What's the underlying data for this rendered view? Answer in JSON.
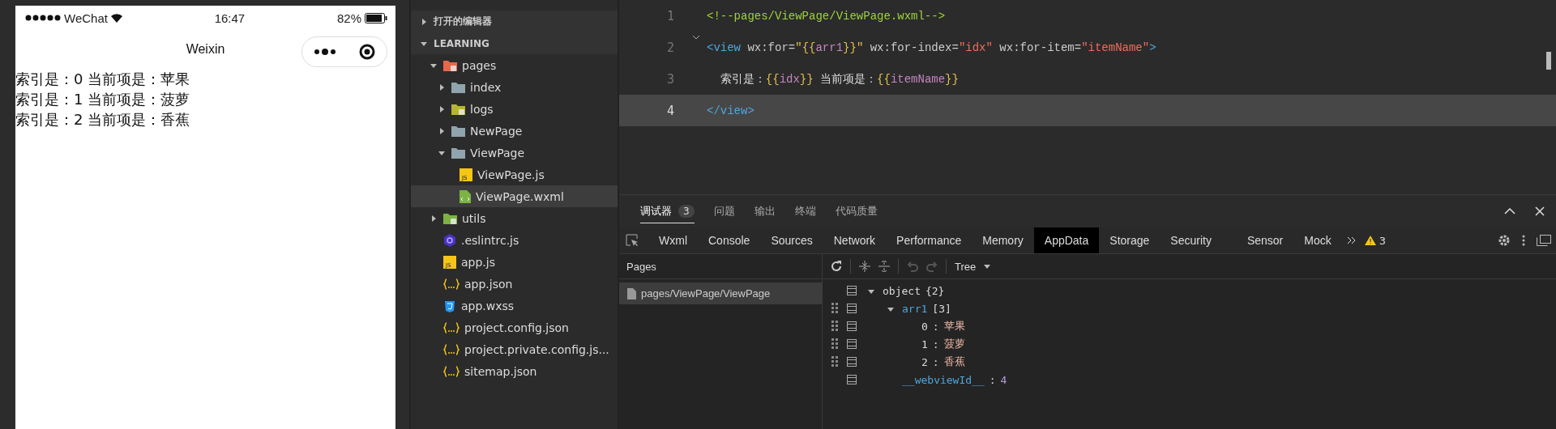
{
  "phone": {
    "carrier": "WeChat",
    "time": "16:47",
    "battery": "82%",
    "nav_title": "Weixin",
    "lines": [
      "索引是：0 当前项是：苹果",
      "索引是：1 当前项是：菠萝",
      "索引是：2 当前项是：香蕉"
    ]
  },
  "explorer": {
    "sections": [
      {
        "label": "打开的编辑器",
        "expanded": false
      },
      {
        "label": "LEARNING",
        "expanded": true
      }
    ],
    "tree": [
      {
        "name": "pages",
        "kind": "folder-pages",
        "expanded": true,
        "selected": false,
        "children": [
          {
            "name": "index",
            "kind": "folder",
            "expanded": false,
            "selected": false
          },
          {
            "name": "logs",
            "kind": "folder-logs",
            "expanded": false,
            "selected": false
          },
          {
            "name": "NewPage",
            "kind": "folder",
            "expanded": false,
            "selected": false
          },
          {
            "name": "ViewPage",
            "kind": "folder",
            "expanded": true,
            "selected": false,
            "children": [
              {
                "name": "ViewPage.js",
                "kind": "js",
                "icon_text": "JS",
                "selected": false
              },
              {
                "name": "ViewPage.wxml",
                "kind": "wxml",
                "selected": true
              }
            ]
          }
        ]
      },
      {
        "name": "utils",
        "kind": "folder-utils",
        "expanded": false,
        "selected": false
      },
      {
        "name": ".eslintrc.js",
        "kind": "eslint",
        "selected": false
      },
      {
        "name": "app.js",
        "kind": "js",
        "icon_text": "JS",
        "selected": false
      },
      {
        "name": "app.json",
        "kind": "json",
        "selected": false
      },
      {
        "name": "app.wxss",
        "kind": "css",
        "selected": false
      },
      {
        "name": "project.config.json",
        "kind": "json",
        "selected": false
      },
      {
        "name": "project.private.config.js...",
        "kind": "json",
        "selected": false
      },
      {
        "name": "sitemap.json",
        "kind": "json",
        "selected": false
      }
    ]
  },
  "editor": {
    "lines": [
      {
        "number": "1",
        "active": false,
        "foldable": false,
        "tokens": [
          {
            "text": "<!--pages/ViewPage/ViewPage.wxml-->",
            "kind": "comment"
          }
        ]
      },
      {
        "number": "2",
        "active": false,
        "foldable": true,
        "tokens": [
          {
            "text": "<view",
            "kind": "tag"
          },
          {
            "text": " wx:for=",
            "kind": "attr"
          },
          {
            "text": "\"",
            "kind": "string"
          },
          {
            "text": "{{",
            "kind": "brace"
          },
          {
            "text": "arr1",
            "kind": "var"
          },
          {
            "text": "}}",
            "kind": "brace"
          },
          {
            "text": "\"",
            "kind": "string"
          },
          {
            "text": " wx:for-index=",
            "kind": "attr"
          },
          {
            "text": "\"idx\"",
            "kind": "string"
          },
          {
            "text": " wx:for-item=",
            "kind": "attr"
          },
          {
            "text": "\"itemName\"",
            "kind": "string"
          },
          {
            "text": ">",
            "kind": "tag"
          }
        ]
      },
      {
        "number": "3",
        "active": false,
        "foldable": false,
        "tokens": [
          {
            "text": "  索引是：",
            "kind": "text"
          },
          {
            "text": "{{",
            "kind": "brace"
          },
          {
            "text": "idx",
            "kind": "var"
          },
          {
            "text": "}}",
            "kind": "brace"
          },
          {
            "text": " 当前项是：",
            "kind": "text"
          },
          {
            "text": "{{",
            "kind": "brace"
          },
          {
            "text": "itemName",
            "kind": "var"
          },
          {
            "text": "}}",
            "kind": "brace"
          }
        ]
      },
      {
        "number": "4",
        "active": true,
        "foldable": false,
        "tokens": [
          {
            "text": "</view>",
            "kind": "tag"
          }
        ]
      }
    ]
  },
  "devtools": {
    "panel_tabs": [
      {
        "label": "调试器",
        "badge": "3",
        "selected": true
      },
      {
        "label": "问题",
        "selected": false
      },
      {
        "label": "输出",
        "selected": false
      },
      {
        "label": "终端",
        "selected": false
      },
      {
        "label": "代码质量",
        "selected": false
      }
    ],
    "tools": [
      {
        "label": "Wxml",
        "selected": false
      },
      {
        "label": "Console",
        "selected": false
      },
      {
        "label": "Sources",
        "selected": false
      },
      {
        "label": "Network",
        "selected": false
      },
      {
        "label": "Performance",
        "selected": false
      },
      {
        "label": "Memory",
        "selected": false
      },
      {
        "label": "AppData",
        "selected": true
      },
      {
        "label": "Storage",
        "selected": false
      },
      {
        "label": "Security",
        "selected": false
      },
      {
        "label": "Sensor",
        "selected": false
      },
      {
        "label": "Mock",
        "selected": false
      }
    ],
    "warnings": "3",
    "view_mode": "Tree",
    "pages_title": "Pages",
    "pages": [
      {
        "label": "pages/ViewPage/ViewPage",
        "selected": true
      }
    ],
    "data": [
      {
        "key": "object",
        "value": "{2}",
        "kind": "object",
        "expanded": true,
        "draggable": false,
        "children": [
          {
            "key": "arr1",
            "value": "[3]",
            "kind": "array",
            "expanded": true,
            "draggable": true,
            "children": [
              {
                "key": "0",
                "separator": ":",
                "value": "苹果",
                "kind": "string",
                "draggable": true
              },
              {
                "key": "1",
                "separator": ":",
                "value": "菠萝",
                "kind": "string",
                "draggable": true
              },
              {
                "key": "2",
                "separator": ":",
                "value": "香蕉",
                "kind": "string",
                "draggable": true
              }
            ]
          },
          {
            "key": "__webviewId__",
            "separator": ":",
            "value": "4",
            "kind": "number",
            "draggable": false
          }
        ]
      }
    ]
  }
}
